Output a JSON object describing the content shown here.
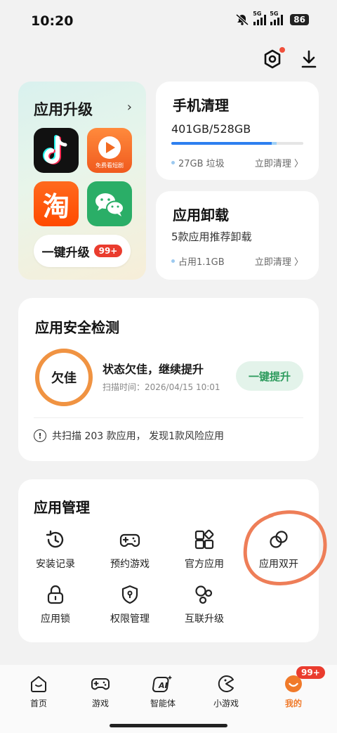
{
  "status": {
    "time": "10:20",
    "net1": "5G",
    "net2": "5G",
    "battery": "86"
  },
  "colors": {
    "accent": "#f07a2a",
    "badge": "#ea3c2e",
    "primary": "#2d7ff0",
    "boost": "#2d9b5d"
  },
  "header": {
    "settings_icon": "settings-icon",
    "download_icon": "download-icon"
  },
  "upgrade": {
    "title": "应用升级",
    "apps": [
      "TikTok",
      "免费看短剧",
      "淘",
      "WeChat"
    ],
    "app2_caption": "免费看短剧",
    "app3_glyph": "淘",
    "one_key_label": "一键升级",
    "badge": "99+"
  },
  "cleanup": {
    "title": "手机清理",
    "usage": "401GB/528GB",
    "used_fraction": 0.76,
    "junk_fraction": 0.04,
    "junk": "27GB 垃圾",
    "action": "立即清理 〉"
  },
  "uninstall": {
    "title": "应用卸载",
    "subtitle": "5款应用推荐卸载",
    "usage": "占用1.1GB",
    "action": "立即清理 〉"
  },
  "security": {
    "title": "应用安全检测",
    "score": "欠佳",
    "state": "状态欠佳，继续提升",
    "scan_time": "扫描时间：2026/04/15 10:01",
    "boost": "一键提升",
    "alert_glyph": "!",
    "summary": "共扫描 203 款应用， 发现1款风险应用"
  },
  "manage": {
    "title": "应用管理",
    "items": [
      {
        "label": "安装记录",
        "icon": "history-icon"
      },
      {
        "label": "预约游戏",
        "icon": "gamepad-icon"
      },
      {
        "label": "官方应用",
        "icon": "apps-grid-icon"
      },
      {
        "label": "应用双开",
        "icon": "dual-app-icon"
      },
      {
        "label": "应用锁",
        "icon": "lock-icon"
      },
      {
        "label": "权限管理",
        "icon": "shield-lock-icon"
      },
      {
        "label": "互联升级",
        "icon": "connect-icon"
      }
    ]
  },
  "tabs": [
    {
      "label": "首页",
      "icon": "home-icon"
    },
    {
      "label": "游戏",
      "icon": "gamepad-icon"
    },
    {
      "label": "智能体",
      "icon": "ai-icon"
    },
    {
      "label": "小游戏",
      "icon": "pacman-icon"
    },
    {
      "label": "我的",
      "icon": "profile-icon"
    }
  ],
  "tab_badge": "99+",
  "active_tab": "我的"
}
